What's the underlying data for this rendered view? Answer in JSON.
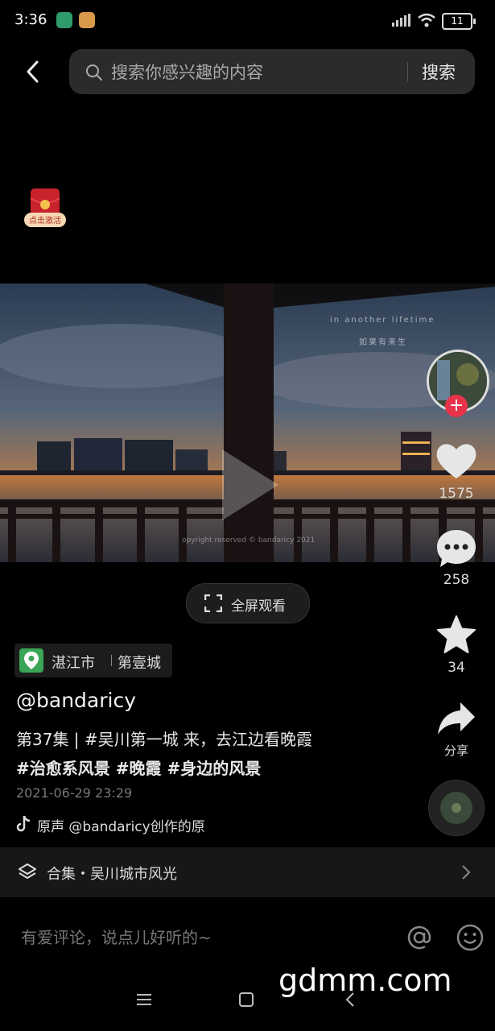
{
  "status_bar": {
    "time": "3:36",
    "battery": "11"
  },
  "search": {
    "placeholder": "搜索你感兴趣的内容",
    "button": "搜索"
  },
  "video": {
    "overlay_line1": "in another lifetime",
    "overlay_line2": "如果有来生",
    "copyright": "opyright reserved © bandaricy 2021"
  },
  "fullscreen_label": "全屏观看",
  "actions": {
    "likes": "1575",
    "comments": "258",
    "favorites": "34",
    "share": "分享"
  },
  "location": {
    "city": "湛江市",
    "place": "第壹城"
  },
  "author": "@bandaricy",
  "description": {
    "line1": "第37集 | #吴川第一城 来，去江边看晚霞",
    "line2": "#治愈系风景 #晚霞  #身边的风景"
  },
  "date": "2021-06-29 23:29",
  "music": "原声   @bandaricy创作的原",
  "collection": "合集・吴川城市风光",
  "comment_placeholder": "有爱评论，说点儿好听的~",
  "watermark": "gdmm.com",
  "colors": {
    "background": "#000000",
    "follow_red": "#e8334a",
    "location_green": "#3aa655"
  }
}
